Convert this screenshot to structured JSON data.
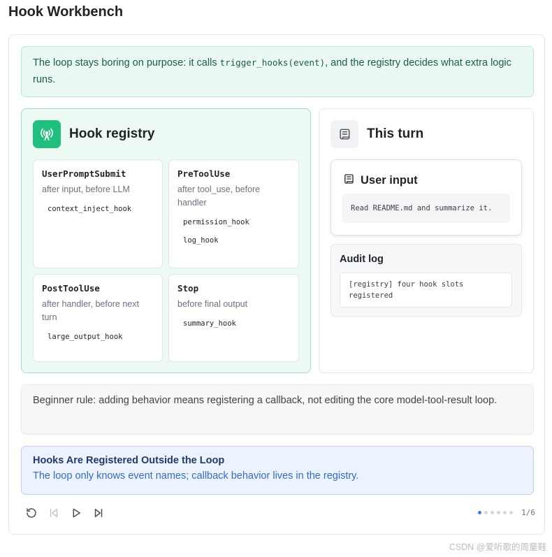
{
  "app": {
    "title": "Hook Workbench"
  },
  "intro": {
    "text_before": "The loop stays boring on purpose: it calls ",
    "code": "trigger_hooks(event)",
    "text_after": ", and the registry decides what extra logic runs."
  },
  "registry": {
    "title": "Hook registry",
    "icon": "broadcast-tower-icon",
    "accent_color": "#1fbf7f",
    "hooks": [
      {
        "name": "UserPromptSubmit",
        "desc": "after input, before LLM",
        "fns": [
          "context_inject_hook"
        ]
      },
      {
        "name": "PreToolUse",
        "desc": "after tool_use, before handler",
        "fns": [
          "permission_hook",
          "log_hook"
        ]
      },
      {
        "name": "PostToolUse",
        "desc": "after handler, before next turn",
        "fns": [
          "large_output_hook"
        ]
      },
      {
        "name": "Stop",
        "desc": "before final output",
        "fns": [
          "summary_hook"
        ]
      }
    ]
  },
  "turn": {
    "title": "This turn",
    "icon": "scroll-icon",
    "user_input": {
      "title": "User input",
      "message": "Read README.md and summarize it."
    },
    "audit": {
      "title": "Audit log",
      "entry": "[registry] four hook slots registered"
    }
  },
  "rule": {
    "text": "Beginner rule: adding behavior means registering a callback, not editing the core model-tool-result loop."
  },
  "callout": {
    "title": "Hooks Are Registered Outside the Loop",
    "body": "The loop only knows event names; callback behavior lives in the registry.",
    "accent_color": "#2f6bd0"
  },
  "player": {
    "current_step": 1,
    "total_steps": 6,
    "counter": "1/6",
    "icons": [
      "restart-icon",
      "step-back-icon",
      "play-icon",
      "step-forward-icon"
    ]
  },
  "watermark": "CSDN @爱听歌的周童鞋"
}
